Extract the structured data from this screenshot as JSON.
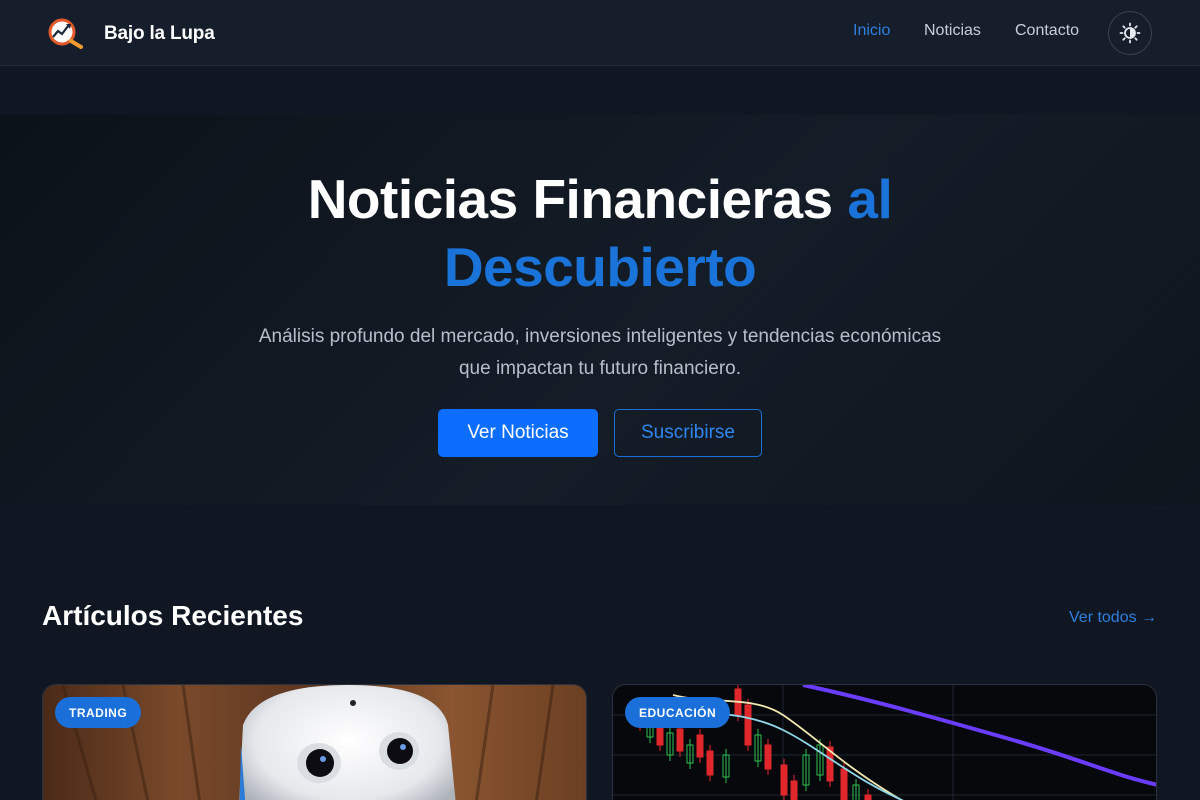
{
  "nav": {
    "brand": "Bajo la Lupa",
    "links": [
      "Inicio",
      "Noticias",
      "Contacto"
    ],
    "active_link": "Inicio",
    "theme_toggle_icon": "theme-toggle-icon"
  },
  "hero": {
    "title_part1": "Noticias Financieras ",
    "title_accent_1": "al",
    "title_accent_2": "Descubierto",
    "subtitle_line1": "Análisis profundo del mercado, inversiones inteligentes y tendencias económicas",
    "subtitle_line2": "que impactan tu futuro financiero.",
    "primary_button": "Ver Noticias",
    "secondary_button": "Suscribirse"
  },
  "recent": {
    "title": "Artículos Recientes",
    "see_all": "Ver todos →",
    "cards": [
      {
        "category": "TRADING",
        "image": "robot-photo"
      },
      {
        "category": "EDUCACIÓN",
        "image": "candlestick-chart-photo"
      }
    ]
  },
  "colors": {
    "accent": "#1a73d8",
    "primary_button": "#0d6efd",
    "background": "#101722",
    "navbar": "#161e2b"
  }
}
